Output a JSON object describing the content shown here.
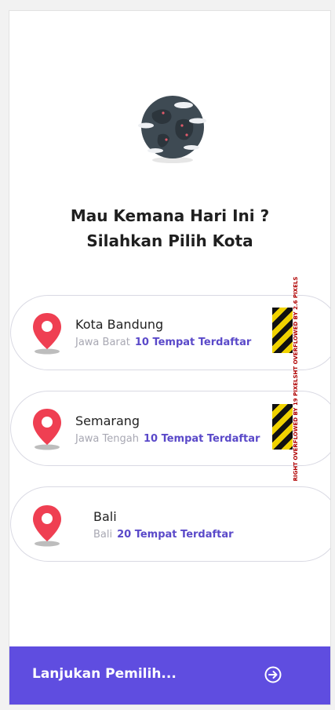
{
  "header": {
    "title_line1": "Mau Kemana Hari Ini ?",
    "title_line2": "Silahkan Pilih Kota"
  },
  "cities": [
    {
      "name": "Kota Bandung",
      "region": "Jawa Barat",
      "count": "10 Tempat Terdaftar"
    },
    {
      "name": "Semarang",
      "region": "Jawa Tengah",
      "count": "10 Tempat Terdaftar"
    },
    {
      "name": "Bali",
      "region": "Bali",
      "count": "20 Tempat Terdaftar"
    }
  ],
  "overflow_warning": "RIGHT OVERFLOWED BY 19 PIXELSHT OVERFLOWED BY 2.6 PIXELS",
  "footer": {
    "continue_label": "Lanjukan Pemilih..."
  },
  "icons": {
    "globe": "globe-icon",
    "pin": "location-pin-icon",
    "arrow": "arrow-circle-right-icon"
  },
  "colors": {
    "accent": "#5f4de0",
    "count": "#5a49c9",
    "pin": "#ef3f52"
  }
}
